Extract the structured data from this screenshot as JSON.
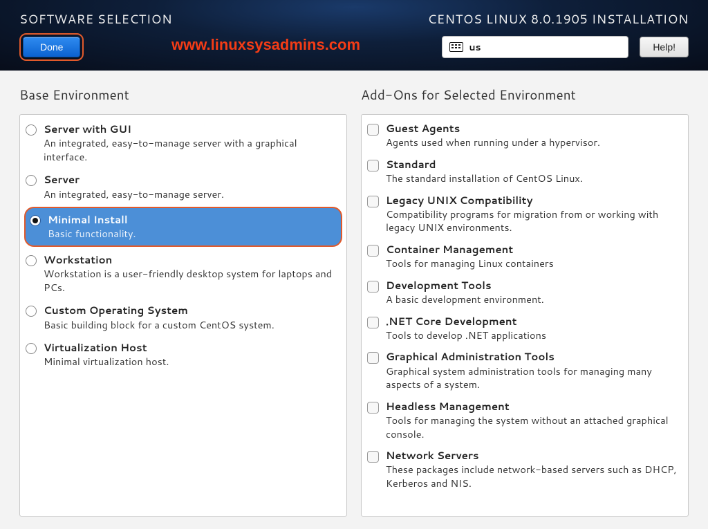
{
  "header": {
    "page_title": "SOFTWARE SELECTION",
    "installer_title": "CENTOS LINUX 8.0.1905 INSTALLATION",
    "done_label": "Done",
    "keyboard_layout": "us",
    "help_label": "Help!",
    "watermark": "www.linuxsysadmins.com"
  },
  "left": {
    "title": "Base Environment",
    "envs": [
      {
        "name": "Server with GUI",
        "desc": "An integrated, easy-to-manage server with a graphical interface.",
        "selected": false
      },
      {
        "name": "Server",
        "desc": "An integrated, easy-to-manage server.",
        "selected": false
      },
      {
        "name": "Minimal Install",
        "desc": "Basic functionality.",
        "selected": true
      },
      {
        "name": "Workstation",
        "desc": "Workstation is a user-friendly desktop system for laptops and PCs.",
        "selected": false
      },
      {
        "name": "Custom Operating System",
        "desc": "Basic building block for a custom CentOS system.",
        "selected": false
      },
      {
        "name": "Virtualization Host",
        "desc": "Minimal virtualization host.",
        "selected": false
      }
    ]
  },
  "right": {
    "title": "Add-Ons for Selected Environment",
    "addons": [
      {
        "name": "Guest Agents",
        "desc": "Agents used when running under a hypervisor.",
        "checked": false
      },
      {
        "name": "Standard",
        "desc": "The standard installation of CentOS Linux.",
        "checked": false
      },
      {
        "name": "Legacy UNIX Compatibility",
        "desc": "Compatibility programs for migration from or working with legacy UNIX environments.",
        "checked": false
      },
      {
        "name": "Container Management",
        "desc": "Tools for managing Linux containers",
        "checked": false
      },
      {
        "name": "Development Tools",
        "desc": "A basic development environment.",
        "checked": false
      },
      {
        "name": ".NET Core Development",
        "desc": "Tools to develop .NET applications",
        "checked": false
      },
      {
        "name": "Graphical Administration Tools",
        "desc": "Graphical system administration tools for managing many aspects of a system.",
        "checked": false
      },
      {
        "name": "Headless Management",
        "desc": "Tools for managing the system without an attached graphical console.",
        "checked": false
      },
      {
        "name": "Network Servers",
        "desc": "These packages include network-based servers such as DHCP, Kerberos and NIS.",
        "checked": false
      }
    ]
  }
}
